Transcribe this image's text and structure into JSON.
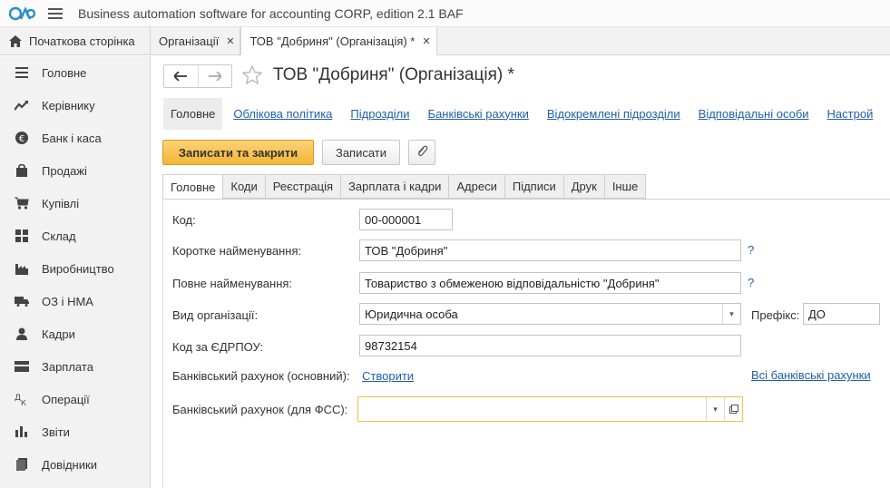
{
  "app": {
    "title": "Business automation software for accounting CORP, edition 2.1 BAF"
  },
  "window_tabs": {
    "home_label": "Початкова сторінка",
    "tabs": [
      {
        "label": "Організації",
        "close": "✕"
      },
      {
        "label": "ТОВ \"Добриня\" (Організація) *",
        "close": "✕"
      }
    ]
  },
  "sidebar": {
    "items": [
      {
        "label": "Головне",
        "icon": "list-icon"
      },
      {
        "label": "Керівнику",
        "icon": "trend-icon"
      },
      {
        "label": "Банк і каса",
        "icon": "coin-icon"
      },
      {
        "label": "Продажі",
        "icon": "bag-icon"
      },
      {
        "label": "Купівлі",
        "icon": "cart-icon"
      },
      {
        "label": "Склад",
        "icon": "grid-icon"
      },
      {
        "label": "Виробництво",
        "icon": "factory-icon"
      },
      {
        "label": "ОЗ і НМА",
        "icon": "truck-icon"
      },
      {
        "label": "Кадри",
        "icon": "person-icon"
      },
      {
        "label": "Зарплата",
        "icon": "wallet-icon"
      },
      {
        "label": "Операції",
        "icon": "dtkt-icon"
      },
      {
        "label": "Звіти",
        "icon": "bar-chart-icon"
      },
      {
        "label": "Довідники",
        "icon": "book-icon"
      }
    ]
  },
  "form": {
    "title": "ТОВ \"Добриня\" (Організація) *",
    "sections": [
      "Головне",
      "Облікова політика",
      "Підрозділи",
      "Банківські рахунки",
      "Відокремлені підрозділи",
      "Відповідальні особи",
      "Настрой"
    ],
    "buttons": {
      "save_close": "Записати та закрити",
      "save": "Записати"
    },
    "tabs": [
      "Головне",
      "Коди",
      "Реєстрація",
      "Зарплата і кадри",
      "Адреси",
      "Підписи",
      "Друк",
      "Інше"
    ],
    "fields": {
      "code_label": "Код:",
      "code_value": "00-000001",
      "short_name_label": "Коротке найменування:",
      "short_name_value": "ТОВ \"Добриня\"",
      "full_name_label": "Повне найменування:",
      "full_name_value": "Товариство з обмеженою відповідальністю \"Добриня\"",
      "org_type_label": "Вид організації:",
      "org_type_value": "Юридична особа",
      "prefix_label": "Префікс:",
      "prefix_value": "ДО",
      "edrpou_label": "Код за ЄДРПОУ:",
      "edrpou_value": "98732154",
      "bank_main_label": "Банківський рахунок (основний):",
      "bank_main_create": "Створити",
      "all_bank_accounts": "Всі банківські рахунки",
      "bank_fss_label": "Банківський рахунок (для ФСС):",
      "bank_fss_value": "",
      "help": "?"
    }
  },
  "colors": {
    "accent_button": "#f5bb40",
    "link": "#2060a8",
    "logo": "#2a8ec8"
  }
}
